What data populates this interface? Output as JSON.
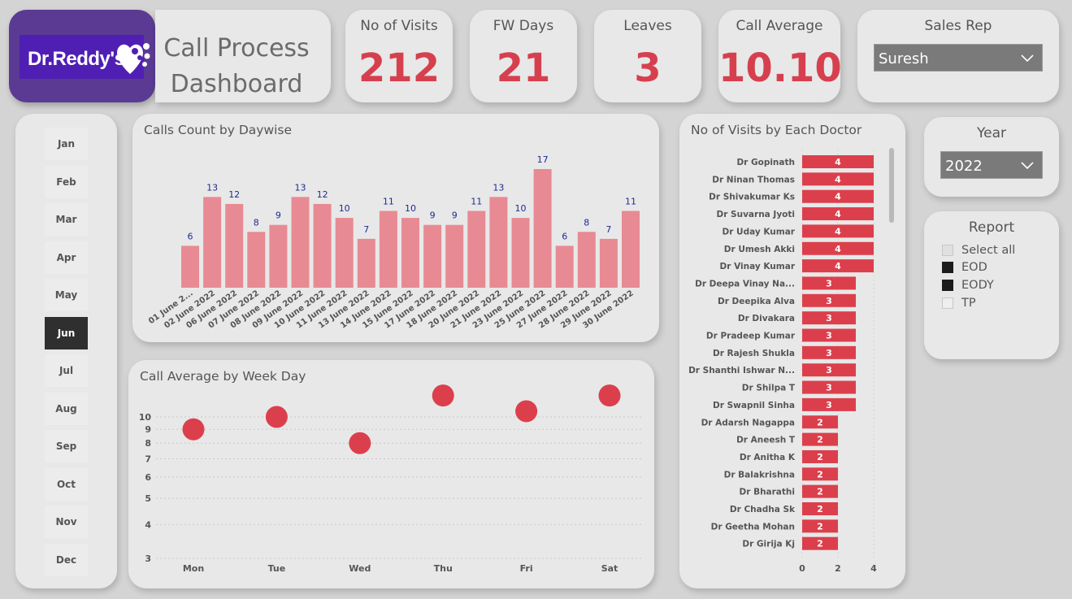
{
  "header": {
    "logo_text": "Dr.Reddy's",
    "title_line1": "Call Process",
    "title_line2": "Dashboard"
  },
  "kpis": [
    {
      "label": "No of Visits",
      "value": "212"
    },
    {
      "label": "FW Days",
      "value": "21"
    },
    {
      "label": "Leaves",
      "value": "3"
    },
    {
      "label": "Call Average",
      "value": "10.10"
    }
  ],
  "sales_rep": {
    "label": "Sales Rep",
    "value": "Suresh"
  },
  "year": {
    "label": "Year",
    "value": "2022"
  },
  "report": {
    "label": "Report",
    "items": [
      {
        "label": "Select all",
        "state": "partial"
      },
      {
        "label": "EOD",
        "state": "checked"
      },
      {
        "label": "EODY",
        "state": "checked"
      },
      {
        "label": "TP",
        "state": "unchecked"
      }
    ]
  },
  "months": {
    "items": [
      "Jan",
      "Feb",
      "Mar",
      "Apr",
      "May",
      "Jun",
      "Jul",
      "Aug",
      "Sep",
      "Oct",
      "Nov",
      "Dec"
    ],
    "selected": "Jun"
  },
  "colors": {
    "accent": "#d6404e",
    "bar_pink": "#e88a93",
    "bar_red": "#dc3f4c",
    "label_blue": "#1f2a8f"
  },
  "chart_data": [
    {
      "type": "bar",
      "title": "Calls Count by Daywise",
      "categories": [
        "01 June 2...",
        "02 June 2022",
        "06 June 2022",
        "07 June 2022",
        "08 June 2022",
        "09 June 2022",
        "10 June 2022",
        "11 June 2022",
        "13 June 2022",
        "14 June 2022",
        "15 June 2022",
        "17 June 2022",
        "18 June 2022",
        "20 June 2022",
        "21 June 2022",
        "23 June 2022",
        "25 June 2022",
        "27 June 2022",
        "28 June 2022",
        "29 June 2022",
        "30 June 2022"
      ],
      "values": [
        6,
        13,
        12,
        8,
        9,
        13,
        12,
        10,
        7,
        11,
        10,
        9,
        9,
        11,
        13,
        10,
        17,
        6,
        8,
        7,
        11
      ],
      "ylim": [
        0,
        17
      ]
    },
    {
      "type": "scatter",
      "title": "Call Average by Week Day",
      "categories": [
        "Mon",
        "Tue",
        "Wed",
        "Thu",
        "Fri",
        "Sat"
      ],
      "values": [
        9,
        10,
        8,
        12,
        10.5,
        12
      ],
      "y_ticks": [
        3,
        4,
        5,
        6,
        7,
        8,
        9,
        10
      ],
      "y_scale": "log",
      "ylim": [
        3,
        12
      ]
    },
    {
      "type": "bar",
      "orientation": "horizontal",
      "title": "No of Visits by Each Doctor",
      "categories": [
        "Dr Gopinath",
        "Dr Ninan Thomas",
        "Dr Shivakumar Ks",
        "Dr Suvarna Jyoti",
        "Dr Uday Kumar",
        "Dr Umesh Akki",
        "Dr Vinay Kumar",
        "Dr Deepa Vinay Na...",
        "Dr Deepika Alva",
        "Dr Divakara",
        "Dr Pradeep Kumar",
        "Dr Rajesh Shukla",
        "Dr Shanthi Ishwar N...",
        "Dr Shilpa T",
        "Dr Swapnil Sinha",
        "Dr Adarsh Nagappa",
        "Dr Aneesh T",
        "Dr Anitha K",
        "Dr Balakrishna",
        "Dr Bharathi",
        "Dr Chadha Sk",
        "Dr Geetha Mohan",
        "Dr Girija Kj"
      ],
      "values": [
        4,
        4,
        4,
        4,
        4,
        4,
        4,
        3,
        3,
        3,
        3,
        3,
        3,
        3,
        3,
        2,
        2,
        2,
        2,
        2,
        2,
        2,
        2
      ],
      "x_ticks": [
        "0",
        "2",
        "4"
      ],
      "xlim": [
        0,
        4
      ]
    }
  ]
}
